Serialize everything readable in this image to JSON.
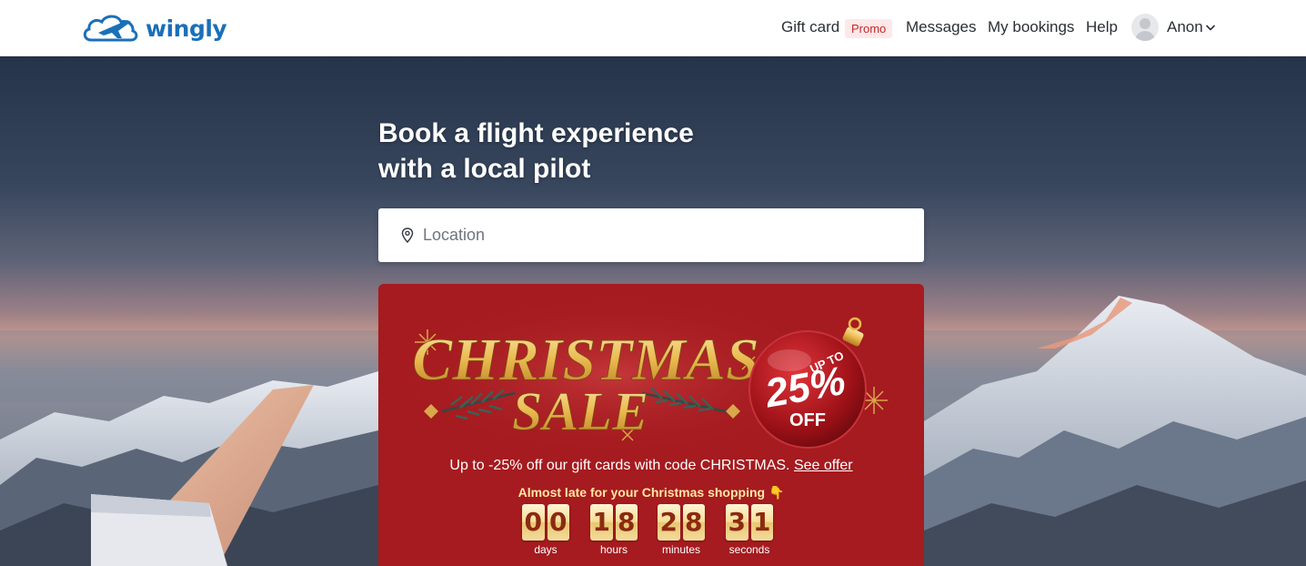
{
  "header": {
    "logo_text": "wingly",
    "nav": {
      "gift_card": "Gift card",
      "promo_badge": "Promo",
      "messages": "Messages",
      "my_bookings": "My bookings",
      "help": "Help",
      "user_name": "Anon"
    }
  },
  "hero": {
    "title_line1": "Book a flight experience",
    "title_line2": "with a local pilot",
    "search": {
      "placeholder": "Location",
      "value": ""
    }
  },
  "promo": {
    "banner": {
      "line1": "CHRISTMAS",
      "line2": "SALE",
      "ornament_top": "UP TO",
      "ornament_value": "25%",
      "ornament_bottom": "OFF"
    },
    "offer_text": "Up to -25% off our gift cards with code CHRISTMAS.",
    "offer_link": "See offer",
    "urgency_text": "Almost late for your Christmas shopping 👇",
    "countdown": {
      "days": {
        "d1": "0",
        "d2": "0",
        "label": "days"
      },
      "hours": {
        "d1": "1",
        "d2": "8",
        "label": "hours"
      },
      "minutes": {
        "d1": "2",
        "d2": "8",
        "label": "minutes"
      },
      "seconds": {
        "d1": "3",
        "d2": "1",
        "label": "seconds"
      }
    }
  },
  "colors": {
    "brand": "#1b6fb8",
    "promo_bg": "#a51b1f",
    "gold": "#f1c96b",
    "promo_badge_bg": "#fde8ea",
    "promo_badge_text": "#c62828"
  },
  "icons": {
    "logo": "plane-cloud-icon",
    "location": "map-pin-icon",
    "user": "avatar-icon",
    "menu": "chevron-down-icon"
  }
}
